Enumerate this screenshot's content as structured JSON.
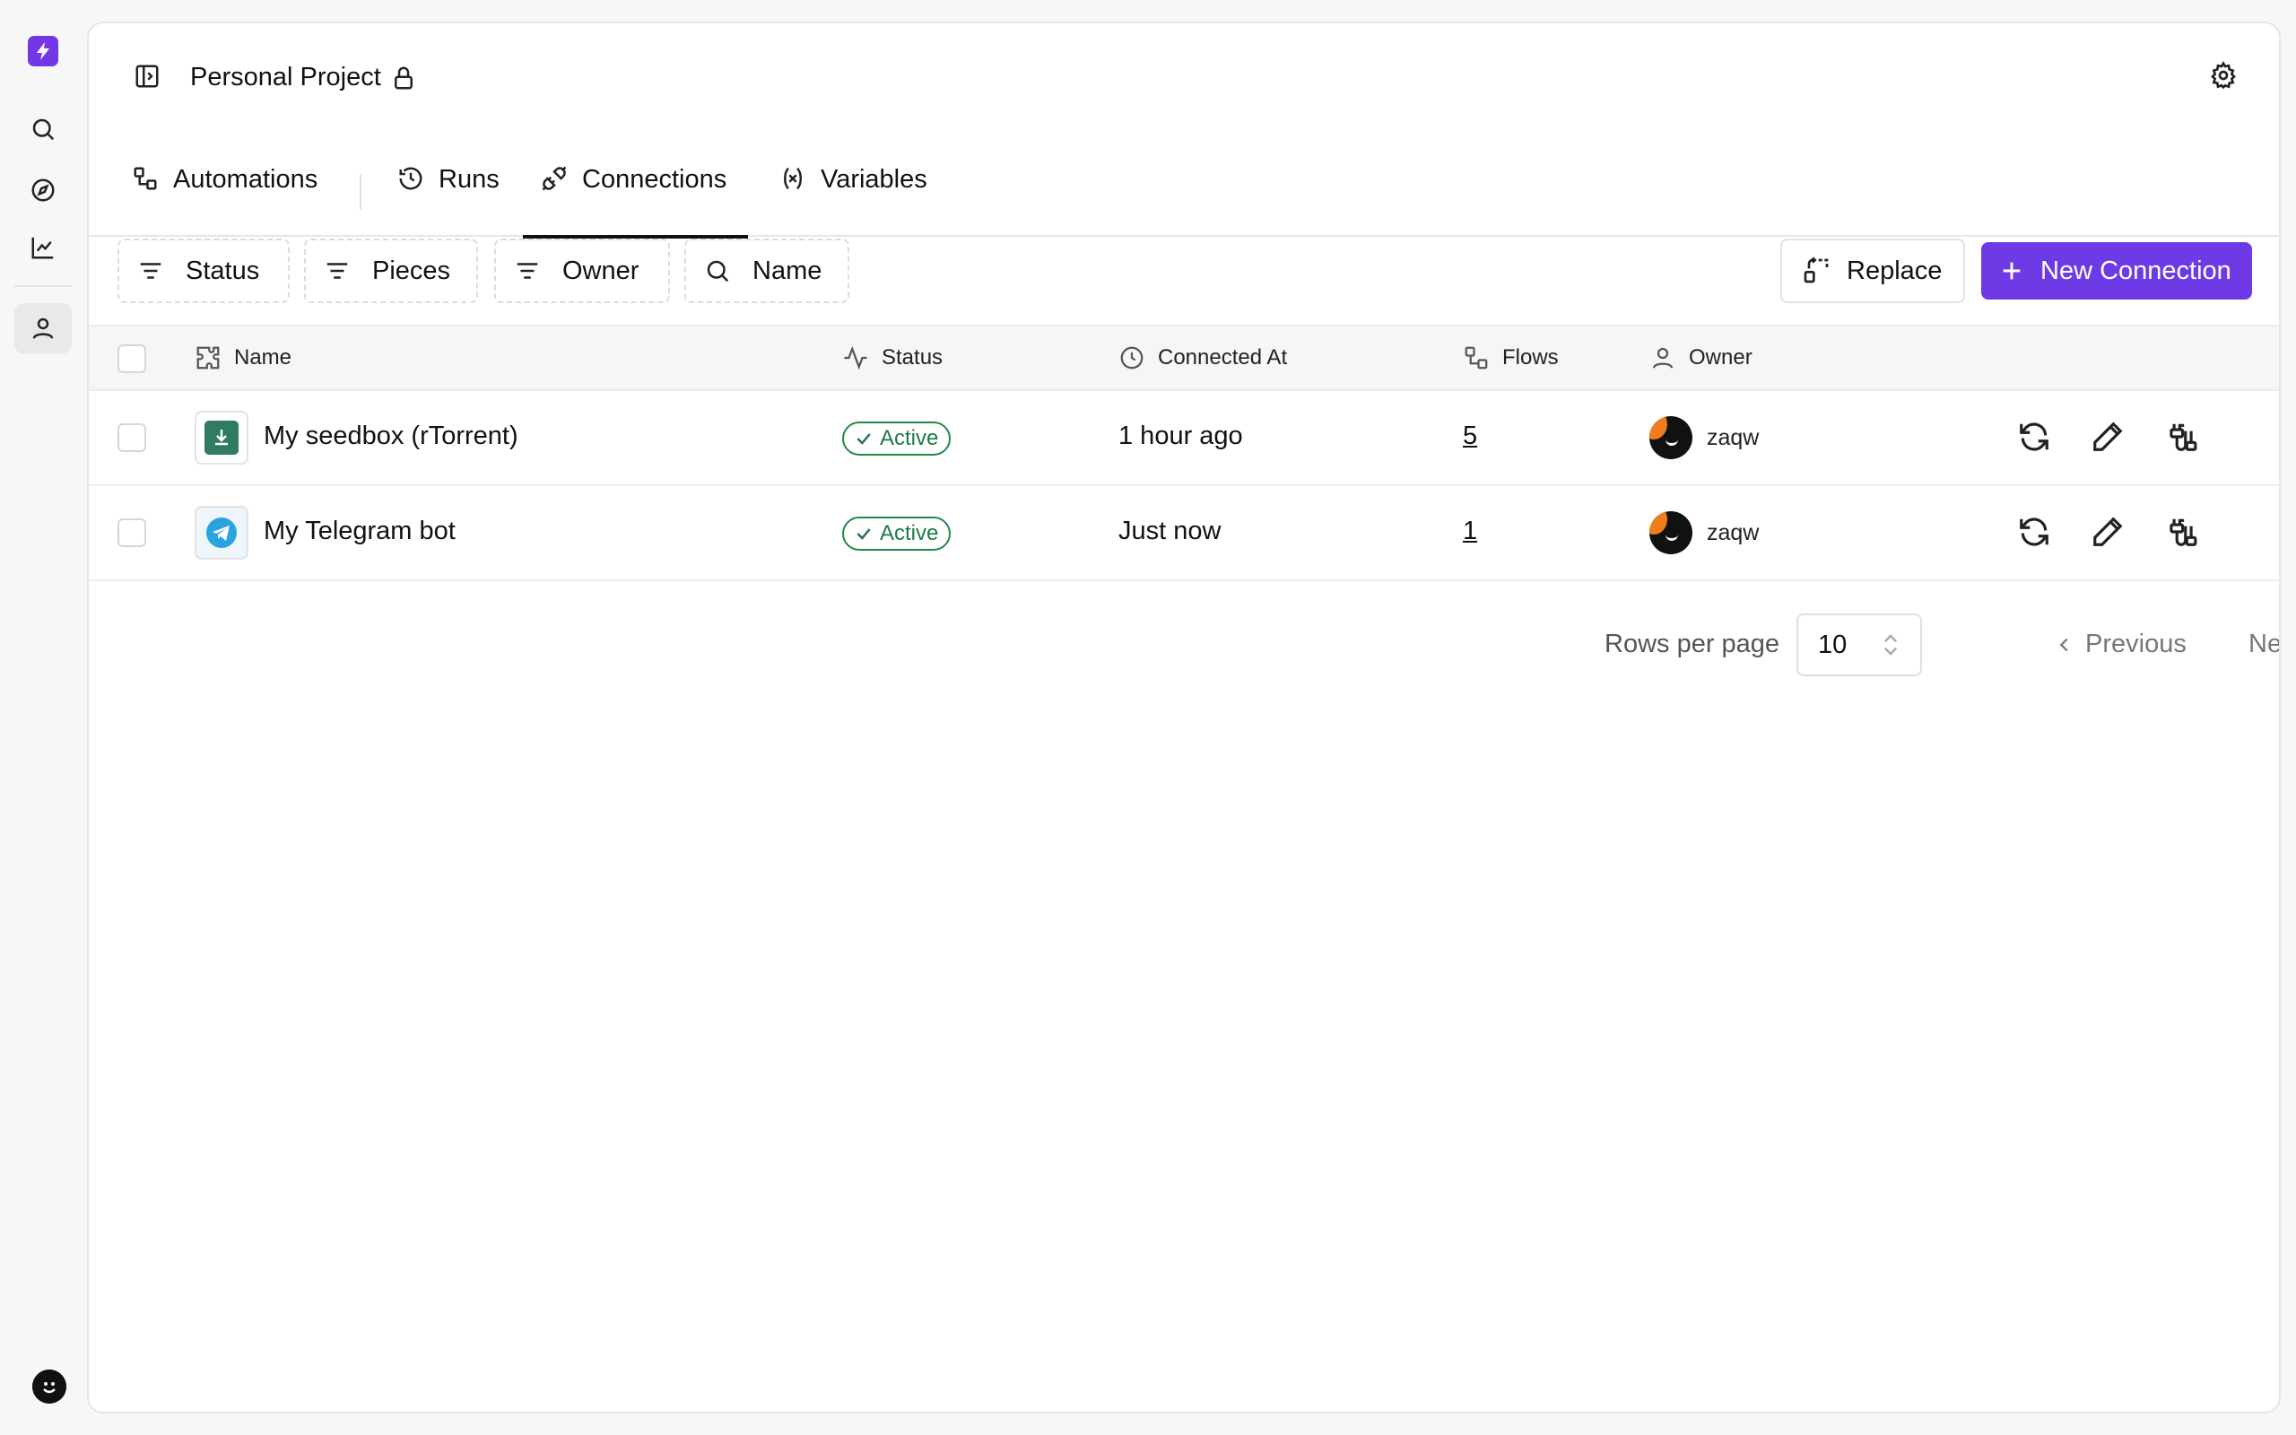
{
  "project": {
    "title": "Personal Project"
  },
  "tabs": [
    {
      "label": "Automations"
    },
    {
      "label": "Runs"
    },
    {
      "label": "Connections"
    },
    {
      "label": "Variables"
    }
  ],
  "filters": {
    "status": "Status",
    "pieces": "Pieces",
    "owner": "Owner",
    "name": "Name"
  },
  "actions": {
    "replace": "Replace",
    "new_connection": "New Connection"
  },
  "table": {
    "headers": {
      "name": "Name",
      "status": "Status",
      "connected_at": "Connected At",
      "flows": "Flows",
      "owner": "Owner"
    },
    "rows": [
      {
        "name": "My seedbox (rTorrent)",
        "status": "Active",
        "connected_at": "1 hour ago",
        "flows": "5",
        "owner": "zaqw",
        "piece_icon": "rtorrent-icon"
      },
      {
        "name": "My Telegram bot",
        "status": "Active",
        "connected_at": "Just now",
        "flows": "1",
        "owner": "zaqw",
        "piece_icon": "telegram-icon"
      }
    ]
  },
  "pagination": {
    "rows_per_page_label": "Rows per page",
    "rows_per_page": "10",
    "previous": "Previous",
    "next": "Next"
  },
  "colors": {
    "brand": "#7437e6",
    "primary_button": "#6e3ae6",
    "status_active": "#1f8a4c"
  }
}
